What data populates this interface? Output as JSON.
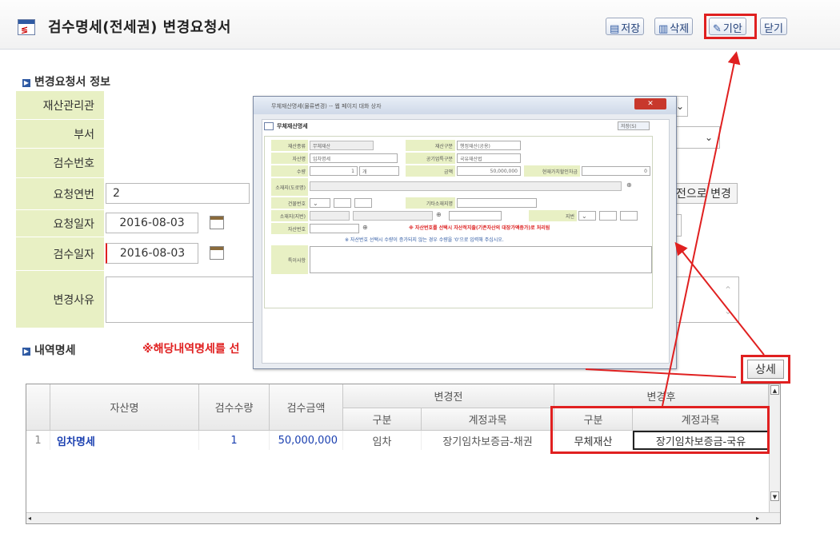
{
  "header": {
    "title": "검수명세(전세권) 변경요청서",
    "icon_label": "≶"
  },
  "toolbar": {
    "save_label": "저장",
    "delete_label": "삭제",
    "draft_label": "기안",
    "close_label": "닫기",
    "save_icon": "save-icon",
    "delete_icon": "trash-icon",
    "draft_icon": "edit-document-icon"
  },
  "info_section": {
    "title": "변경요청서 정보"
  },
  "form": {
    "asset_manager_label": "재산관리관",
    "dept_label": "부서",
    "inspect_no_label": "검수번호",
    "req_seq_label": "요청연번",
    "req_seq_value": "2",
    "req_date_label": "요청일자",
    "req_date_value": "2016-08-03",
    "inspect_date_label": "검수일자",
    "inspect_date_value": "2016-08-03",
    "reason_label": "변경사유",
    "change_all_partial": "전으로 변경"
  },
  "detail_section": {
    "title": "내역명세",
    "notice": "※해당내역명세를 선"
  },
  "detail_button": "상세",
  "dialog": {
    "title": "무체재산명세",
    "titlebar_text": "무체재산명세(물류변경) -- 웹 페이지 대화 상자",
    "save_label": "저장(S)",
    "fields": {
      "type_label": "재산종류",
      "type_value": "무체재산",
      "asset_class_label": "재산구분",
      "asset_class_value": "행정재산(공용)",
      "name_label": "자산명",
      "name_value": "임차명세",
      "acct_class_label": "공기업특구분",
      "acct_class_value": "국유재산법",
      "qty_label": "수량",
      "qty_value": "1",
      "unit_value": "개",
      "amount_label": "금액",
      "amount_value": "50,000,000",
      "curr_value_label": "현재가치할인차금",
      "curr_value_value": "0",
      "location_label": "소재지(도로명)",
      "building_label": "건물번호",
      "other_label": "기타소재지명",
      "lot_label": "소재지(지번)",
      "jibun_label": "지번",
      "asset_no_label": "자산번호",
      "warning1": "※ 자산번호를 선택시 자산적지출(기존자산의 대장가액증가)로 처리됨",
      "warning2": "※ 자산번호 선택시 수량이 증가되지 않는 경우 수량을 '0'으로 입력해 주십시오.",
      "remark_label": "특이사항"
    }
  },
  "table": {
    "headers": {
      "asset_name": "자산명",
      "qty": "검수수량",
      "amount": "검수금액",
      "before": "변경전",
      "after": "변경후",
      "before_type": "구분",
      "before_account": "계정과목",
      "after_type": "구분",
      "after_account": "계정과목"
    },
    "rows": [
      {
        "no": "1",
        "asset_name": "임차명세",
        "qty": "1",
        "amount": "50,000,000",
        "before_type": "임차",
        "before_account": "장기임차보증금-채권",
        "after_type": "무체재산",
        "after_account": "장기임차보증금-국유"
      }
    ]
  },
  "colors": {
    "accent": "#2f5aa3",
    "highlight": "#e02020",
    "label_bg": "#e8f0c4"
  }
}
